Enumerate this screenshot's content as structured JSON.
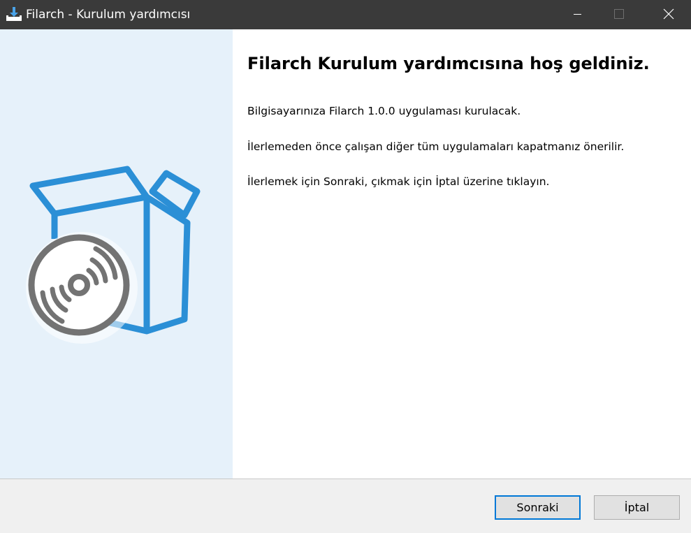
{
  "window": {
    "title": "Filarch - Kurulum yardımcısı"
  },
  "icons": {
    "app": "installer-icon",
    "minimize": "minimize-icon",
    "maximize": "maximize-icon",
    "close": "close-icon",
    "banner": "software-box-disc-illustration"
  },
  "content": {
    "heading": "Filarch Kurulum yardımcısına hoş geldiniz.",
    "paragraphs": [
      "Bilgisayarınıza Filarch 1.0.0 uygulaması kurulacak.",
      "İlerlemeden önce çalışan diğer tüm uygulamaları kapatmanız önerilir.",
      "İlerlemek için Sonraki, çıkmak için İptal üzerine tıklayın."
    ]
  },
  "footer": {
    "next_label": "Sonraki",
    "cancel_label": "İptal"
  },
  "colors": {
    "titlebar": "#3a3a3a",
    "banner_bg": "#e6f1fa",
    "accent_blue": "#2b8fd6",
    "disc_gray": "#737373",
    "focus_border": "#0078d7",
    "footer_bg": "#f0f0f0"
  }
}
